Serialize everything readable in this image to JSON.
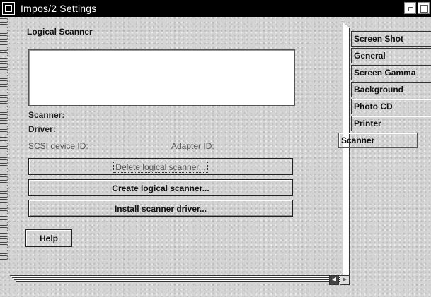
{
  "window": {
    "title": "Impos/2 Settings"
  },
  "page": {
    "title": "Logical Scanner",
    "labels": {
      "scanner": "Scanner:",
      "driver": "Driver:",
      "scsi": "SCSI device ID:",
      "adapter": "Adapter ID:"
    },
    "buttons": {
      "delete": "Delete logical scanner...",
      "create": "Create logical scanner...",
      "install": "Install scanner driver...",
      "help": "Help"
    }
  },
  "tabs": [
    "Screen Shot",
    "General",
    "Screen Gamma",
    "Background",
    "Photo CD",
    "Printer",
    "Scanner"
  ],
  "active_tab": "Scanner",
  "nav": {
    "prev": "◄",
    "next": "►"
  },
  "icons": [
    "system-menu-icon",
    "minimize-icon",
    "maximize-icon",
    "page-back-icon",
    "page-forward-icon"
  ]
}
